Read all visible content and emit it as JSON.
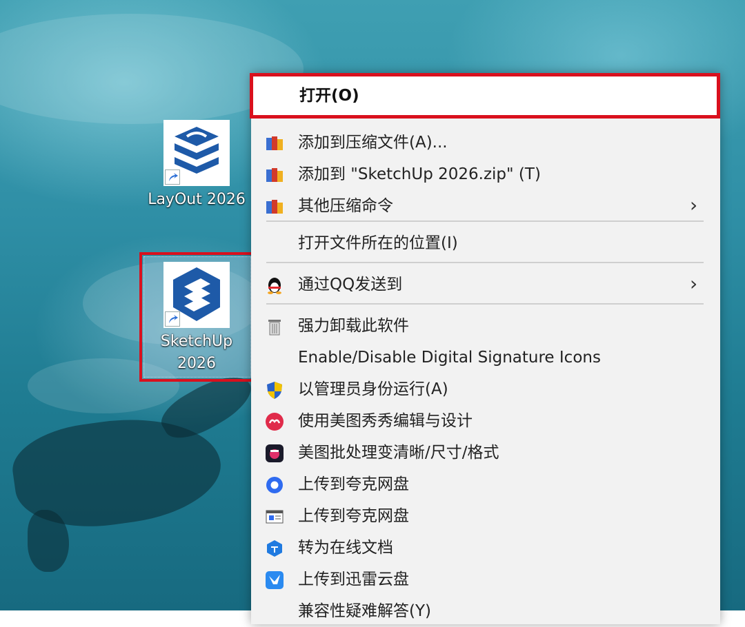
{
  "desktop": {
    "icons": [
      {
        "label": "LayOut 2026",
        "icon": "layout-app-icon"
      },
      {
        "label": "SketchUp 2026",
        "icon": "sketchup-app-icon"
      }
    ]
  },
  "context_menu": {
    "items": [
      {
        "label": "打开(O)",
        "icon": "none"
      },
      {
        "label": "添加到压缩文件(A)...",
        "icon": "archive-books-icon"
      },
      {
        "label": "添加到 \"SketchUp 2026.zip\" (T)",
        "icon": "archive-books-icon"
      },
      {
        "label": "其他压缩命令",
        "icon": "archive-books-icon",
        "submenu": "›"
      },
      {
        "label": "打开文件所在的位置(I)",
        "icon": "none"
      },
      {
        "label": "通过QQ发送到",
        "icon": "qq-penguin-icon",
        "submenu": "›"
      },
      {
        "label": "强力卸载此软件",
        "icon": "trash-bin-icon"
      },
      {
        "label": "Enable/Disable Digital Signature Icons",
        "icon": "none"
      },
      {
        "label": "以管理员身份运行(A)",
        "icon": "uac-shield-icon"
      },
      {
        "label": "使用美图秀秀编辑与设计",
        "icon": "meitu-icon"
      },
      {
        "label": "美图批处理变清晰/尺寸/格式",
        "icon": "meitu-batch-icon"
      },
      {
        "label": "上传到夸克网盘",
        "icon": "quark-icon"
      },
      {
        "label": "上传到夸克网盘",
        "icon": "quark-window-icon"
      },
      {
        "label": "转为在线文档",
        "icon": "online-doc-icon"
      },
      {
        "label": "上传到迅雷云盘",
        "icon": "thunder-bird-icon"
      },
      {
        "label": "兼容性疑难解答(Y)",
        "icon": "none"
      }
    ]
  },
  "colors": {
    "highlight": "#d9101d",
    "menu_bg": "#f2f2f2"
  }
}
